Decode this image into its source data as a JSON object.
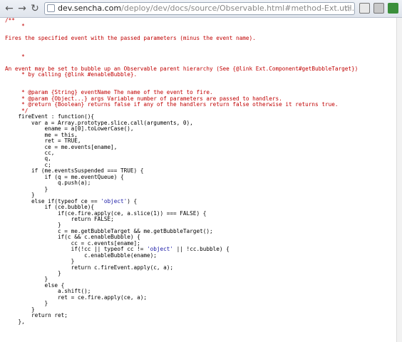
{
  "browser": {
    "back_glyph": "←",
    "forward_glyph": "→",
    "reload_glyph": "↻",
    "url_host": "dev.sencha.com",
    "url_path": "/deploy/dev/docs/source/Observable.html#method-Ext.util.Observable-fireEvent",
    "star_glyph": "☆",
    "icons": [
      "page-icon",
      "wrench-icon",
      "extension-icon"
    ]
  },
  "colors": {
    "comment": "#c00000",
    "string": "#1a1aa6",
    "keyword": "#0000c0",
    "code": "#000000"
  },
  "code": {
    "line_01": "/**",
    "line_02": "     *",
    "line_03": "Fires the specified event with the passed parameters (minus the event name).",
    "line_04": "",
    "line_05": "",
    "line_06": "     *",
    "line_07": "",
    "line_08": "An event may be set to bubble up an Observable parent hierarchy (See {@link Ext.Component#getBubbleTarget})",
    "line_09": "     * by calling {@link #enableBubble}.",
    "line_10": "",
    "line_11": "",
    "line_12": "     * @param {String} eventName The name of the event to fire.",
    "line_13": "     * @param {Object...} args Variable number of parameters are passed to handlers.",
    "line_14": "     * @return {Boolean} returns false if any of the handlers return false otherwise it returns true.",
    "line_15": "     */",
    "line_16": "    fireEvent : function(){",
    "line_17": "        var a = Array.prototype.slice.call(arguments, 0),",
    "line_18": "            ename = a[0].toLowerCase(),",
    "line_19": "            me = this,",
    "line_20": "            ret = TRUE,",
    "line_21": "            ce = me.events[ename],",
    "line_22": "            cc,",
    "line_23": "            q,",
    "line_24": "            c;",
    "line_25": "        if (me.eventsSuspended === TRUE) {",
    "line_26": "            if (q = me.eventQueue) {",
    "line_27": "                q.push(a);",
    "line_28": "            }",
    "line_29": "        }",
    "line_30a": "        else if(typeof ce == ",
    "line_30s": "'object'",
    "line_30b": ") {",
    "line_31": "            if (ce.bubble){",
    "line_32": "                if(ce.fire.apply(ce, a.slice(1)) === FALSE) {",
    "line_33": "                    return FALSE;",
    "line_34": "                }",
    "line_35": "                c = me.getBubbleTarget && me.getBubbleTarget();",
    "line_36": "                if(c && c.enableBubble) {",
    "line_37": "                    cc = c.events[ename];",
    "line_38a": "                    if(!cc || typeof cc != ",
    "line_38s": "'object'",
    "line_38b": " || !cc.bubble) {",
    "line_39": "                        c.enableBubble(ename);",
    "line_40": "                    }",
    "line_41": "                    return c.fireEvent.apply(c, a);",
    "line_42": "                }",
    "line_43": "            }",
    "line_44": "            else {",
    "line_45": "                a.shift();",
    "line_46": "                ret = ce.fire.apply(ce, a);",
    "line_47": "            }",
    "line_48": "        }",
    "line_49": "        return ret;",
    "line_50": "    },"
  }
}
